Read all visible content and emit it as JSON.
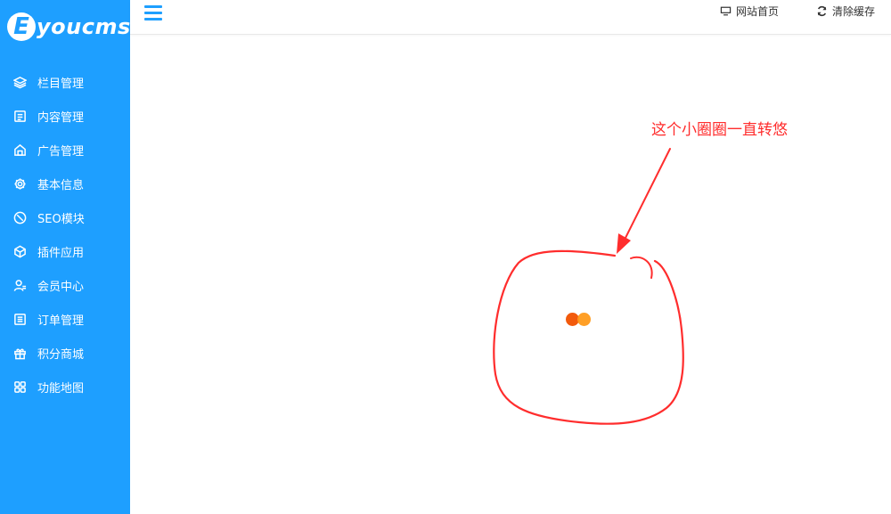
{
  "brand": {
    "logo_letter": "E",
    "logo_text": "youcms"
  },
  "sidebar": {
    "items": [
      {
        "label": "栏目管理",
        "icon": "layers-icon"
      },
      {
        "label": "内容管理",
        "icon": "document-icon"
      },
      {
        "label": "广告管理",
        "icon": "ad-icon"
      },
      {
        "label": "基本信息",
        "icon": "gear-icon"
      },
      {
        "label": "SEO模块",
        "icon": "seo-icon"
      },
      {
        "label": "插件应用",
        "icon": "plugin-icon"
      },
      {
        "label": "会员中心",
        "icon": "user-icon"
      },
      {
        "label": "订单管理",
        "icon": "order-icon"
      },
      {
        "label": "积分商城",
        "icon": "gift-icon"
      },
      {
        "label": "功能地图",
        "icon": "grid-icon"
      }
    ]
  },
  "header": {
    "menu_icon": "hamburger-icon",
    "links": [
      {
        "label": "网站首页",
        "icon": "monitor-icon"
      },
      {
        "label": "清除缓存",
        "icon": "refresh-icon"
      }
    ]
  },
  "annotation": {
    "text": "这个小圈圈一直转悠",
    "color": "#ff2d2d"
  },
  "loader": {
    "colors": [
      "#f25a0c",
      "#ff9a1a"
    ]
  },
  "colors": {
    "sidebar": "#1e9fff",
    "accent": "#1e9fff"
  }
}
